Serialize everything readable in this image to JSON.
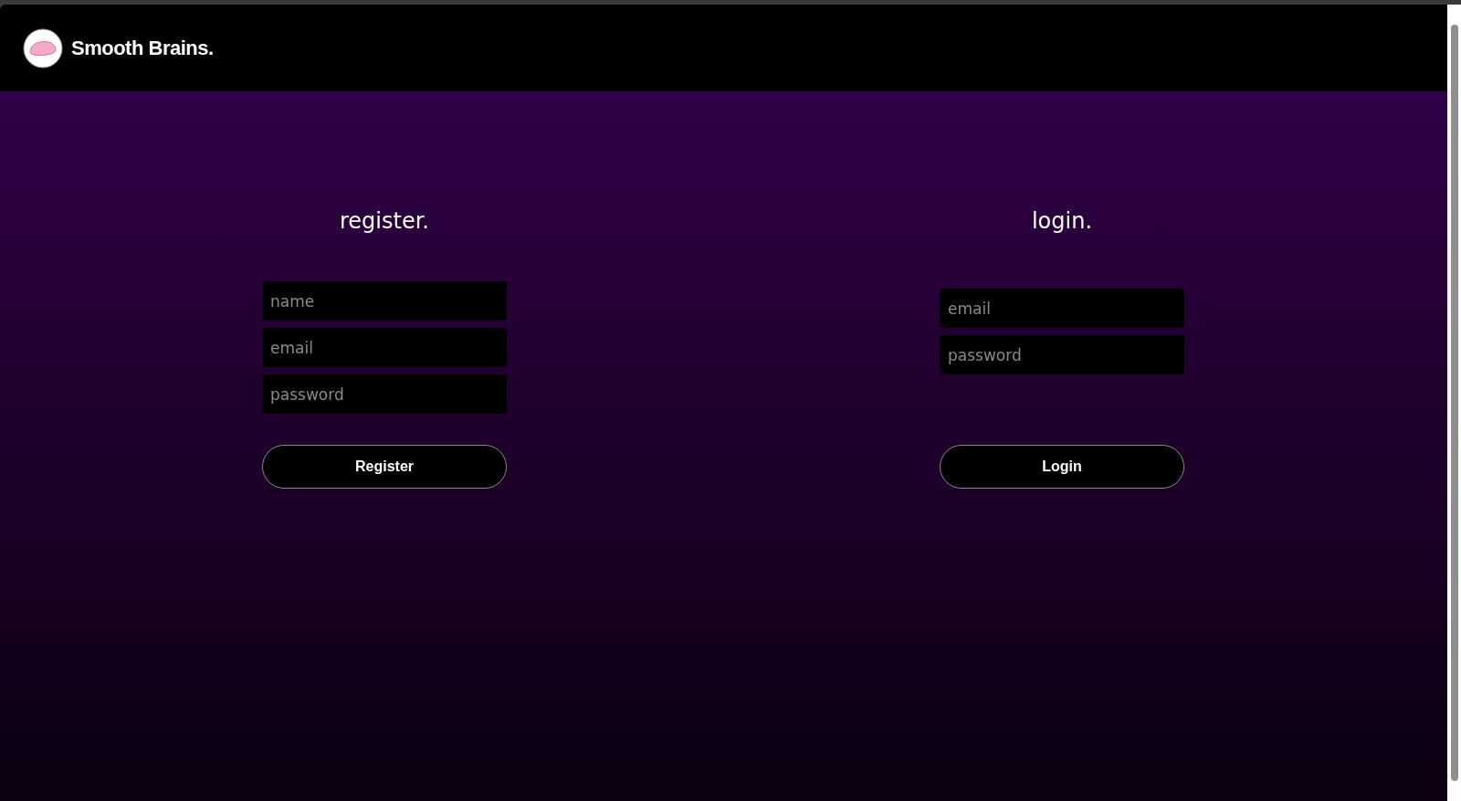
{
  "header": {
    "brand": "Smooth Brains."
  },
  "forms": [
    {
      "title": "register.",
      "fields": [
        {
          "placeholder": "name"
        },
        {
          "placeholder": "email"
        },
        {
          "placeholder": "password"
        }
      ],
      "button": "Register"
    },
    {
      "title": "login.",
      "fields": [
        {
          "placeholder": "email"
        },
        {
          "placeholder": "password"
        }
      ],
      "button": "Login"
    }
  ]
}
